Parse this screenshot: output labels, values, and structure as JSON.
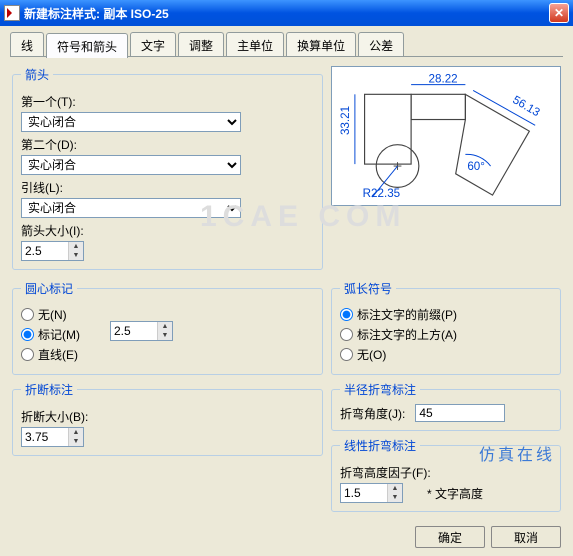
{
  "window": {
    "title": "新建标注样式: 副本 ISO-25"
  },
  "tabs": {
    "items": [
      "线",
      "符号和箭头",
      "文字",
      "调整",
      "主单位",
      "换算单位",
      "公差"
    ],
    "active_index": 1
  },
  "arrowheads": {
    "legend": "箭头",
    "first_label": "第一个(T):",
    "first_value": "实心闭合",
    "second_label": "第二个(D):",
    "second_value": "实心闭合",
    "leader_label": "引线(L):",
    "leader_value": "实心闭合",
    "size_label": "箭头大小(I):",
    "size_value": "2.5"
  },
  "center_marks": {
    "legend": "圆心标记",
    "none_label": "无(N)",
    "mark_label": "标记(M)",
    "line_label": "直线(E)",
    "value": "2.5",
    "selected": "mark"
  },
  "break_dim": {
    "legend": "折断标注",
    "size_label": "折断大小(B):",
    "size_value": "3.75"
  },
  "arc_length": {
    "legend": "弧长符号",
    "preceding_label": "标注文字的前缀(P)",
    "above_label": "标注文字的上方(A)",
    "none_label": "无(O)",
    "selected": "preceding"
  },
  "radius_jog": {
    "legend": "半径折弯标注",
    "angle_label": "折弯角度(J):",
    "angle_value": "45"
  },
  "linear_jog": {
    "legend": "线性折弯标注",
    "factor_label": "折弯高度因子(F):",
    "factor_value": "1.5",
    "suffix": "* 文字高度"
  },
  "preview": {
    "dim_top": "28.22",
    "dim_left": "33.21",
    "dim_diag": "56.13",
    "dim_angle": "60°",
    "dim_radius": "R22.35"
  },
  "buttons": {
    "ok": "确定",
    "cancel": "取消"
  },
  "watermark": "仿真在线",
  "faded": "1CAE COM"
}
